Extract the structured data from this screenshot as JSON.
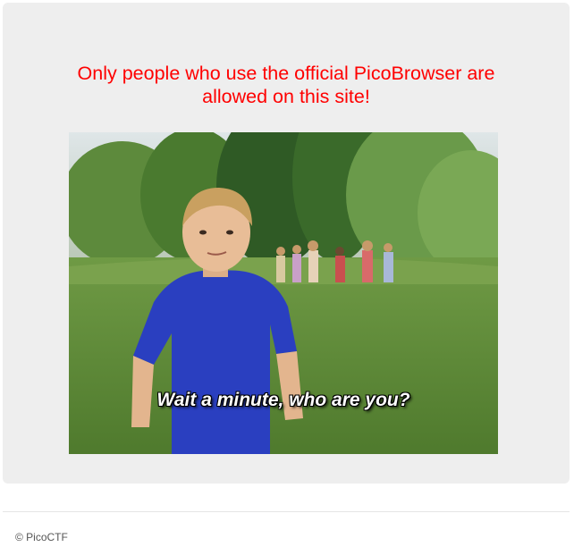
{
  "headline": {
    "line1": "Only people who use the official PicoBrowser are",
    "line2": "allowed on this site!"
  },
  "image": {
    "caption": "Wait a minute, who are you?"
  },
  "footer": {
    "text": "© PicoCTF"
  },
  "colors": {
    "headline": "#ff0000",
    "panel_background": "#eeeeee",
    "footer_text": "#555555"
  }
}
